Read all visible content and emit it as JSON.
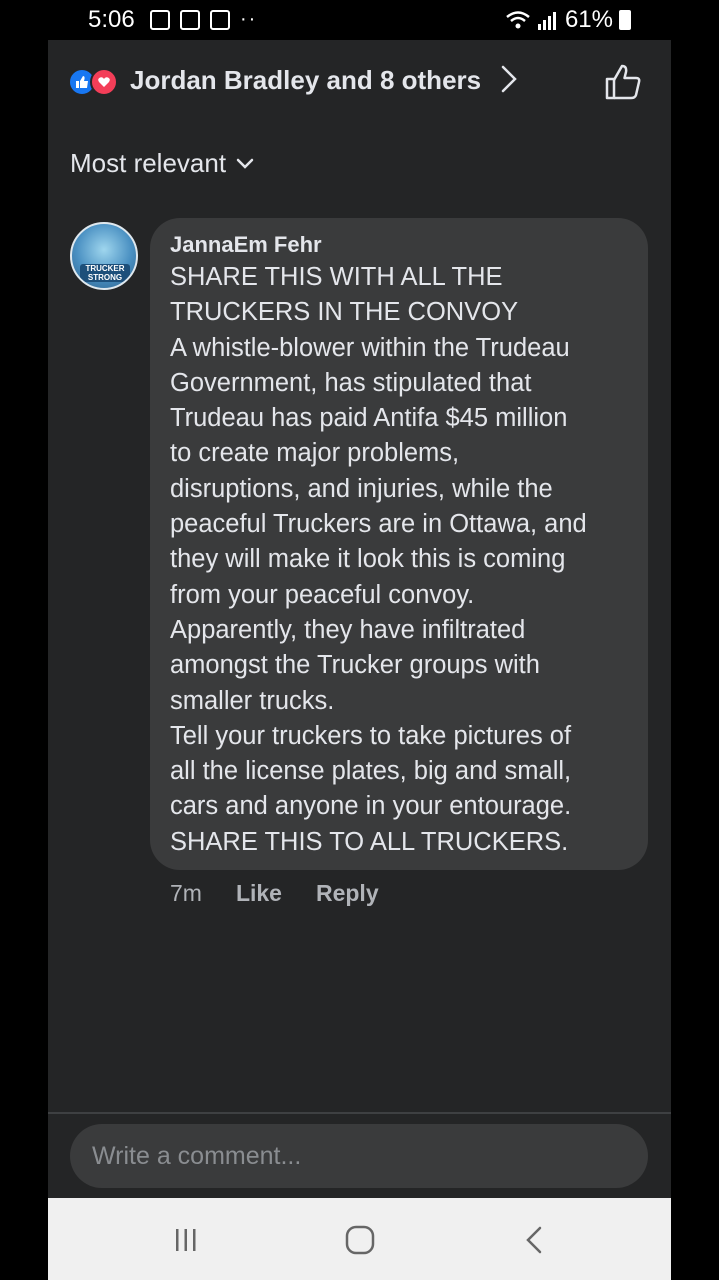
{
  "status_bar": {
    "time": "5:06",
    "battery": "61%"
  },
  "header": {
    "likers_text": "Jordan Bradley and 8 others",
    "reaction_icons": [
      "like-icon",
      "love-icon"
    ]
  },
  "sort": {
    "label": "Most relevant"
  },
  "comment": {
    "author": "JannaEm Fehr",
    "avatar_text": "TRUCKER STRONG",
    "text": "SHARE THIS WITH ALL THE\nTRUCKERS IN THE CONVOY\nA whistle-blower within the Trudeau\nGovernment, has stipulated that\nTrudeau has paid Antifa $45 million\nto create major problems,\ndisruptions, and injuries, while the\npeaceful Truckers are in Ottawa, and\nthey will make it look this is coming\nfrom your peaceful convoy.\nApparently, they have infiltrated\namongst the Trucker groups with\nsmaller trucks.\nTell your truckers to take pictures of\nall the license plates, big and small,\ncars and anyone in your entourage.\nSHARE THIS TO ALL TRUCKERS.",
    "time": "7m",
    "like_label": "Like",
    "reply_label": "Reply"
  },
  "composer": {
    "placeholder": "Write a comment..."
  },
  "colors": {
    "background": "#242526",
    "bubble": "#3a3b3c",
    "like_blue": "#1877f2",
    "love_red": "#f33e58"
  }
}
